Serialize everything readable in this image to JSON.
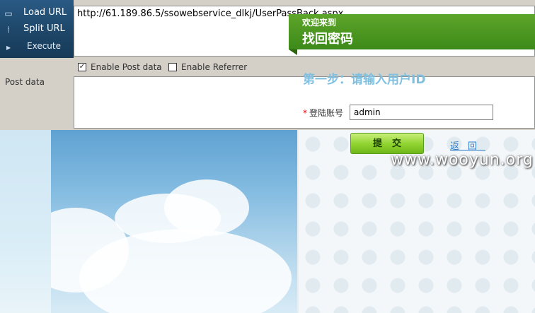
{
  "toolbar": {
    "load_url": "Load URL",
    "split_url": "Split URL",
    "execute": "Execute",
    "url_value": "http://61.189.86.5/ssowebservice_dlkj/UserPassBack.aspx",
    "enable_post_label": "Enable Post data",
    "enable_post_checked": "✓",
    "enable_referrer_label": "Enable Referrer",
    "post_data_label": "Post data",
    "post_data_value": ""
  },
  "page": {
    "welcome": "欢迎来到",
    "title": "找回密码",
    "step": "第一步：请输入用户ID",
    "account_label": "登陆账号",
    "account_required_mark": "*",
    "account_value": "admin",
    "submit_label": "提交",
    "back_label": "返回",
    "watermark": "www.wooyun.org"
  },
  "colors": {
    "banner_green": "#3c8a19",
    "step_blue": "#7fc0e0",
    "link_blue": "#2a79c8",
    "toolbar_blue": "#1d4668"
  }
}
